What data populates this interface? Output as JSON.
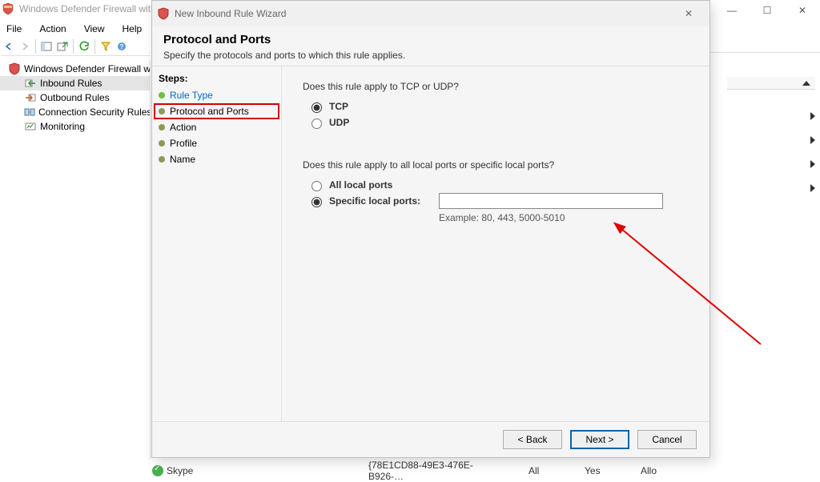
{
  "mmc": {
    "title": "Windows Defender Firewall with",
    "menu": {
      "file": "File",
      "action": "Action",
      "view": "View",
      "help": "Help"
    },
    "tree": {
      "root": "Windows Defender Firewall with",
      "items": [
        "Inbound Rules",
        "Outbound Rules",
        "Connection Security Rules",
        "Monitoring"
      ]
    },
    "status": {
      "app": "Skype",
      "guid": "{78E1CD88-49E3-476E-B926-…",
      "c3": "All",
      "c4": "Yes",
      "c5": "Allo"
    }
  },
  "wizard": {
    "window_title": "New Inbound Rule Wizard",
    "header_title": "Protocol and Ports",
    "header_sub": "Specify the protocols and ports to which this rule applies.",
    "steps_label": "Steps:",
    "steps": {
      "rule_type": "Rule Type",
      "protocol_ports": "Protocol and Ports",
      "action": "Action",
      "profile": "Profile",
      "name": "Name"
    },
    "q_protocol": "Does this rule apply to TCP or UDP?",
    "opt_tcp": "TCP",
    "opt_udp": "UDP",
    "q_ports": "Does this rule apply to all local ports or specific local ports?",
    "opt_all_ports": "All local ports",
    "opt_specific_ports": "Specific local ports:",
    "ports_value": "",
    "ports_example": "Example: 80, 443, 5000-5010",
    "buttons": {
      "back": "< Back",
      "next": "Next >",
      "cancel": "Cancel"
    }
  }
}
